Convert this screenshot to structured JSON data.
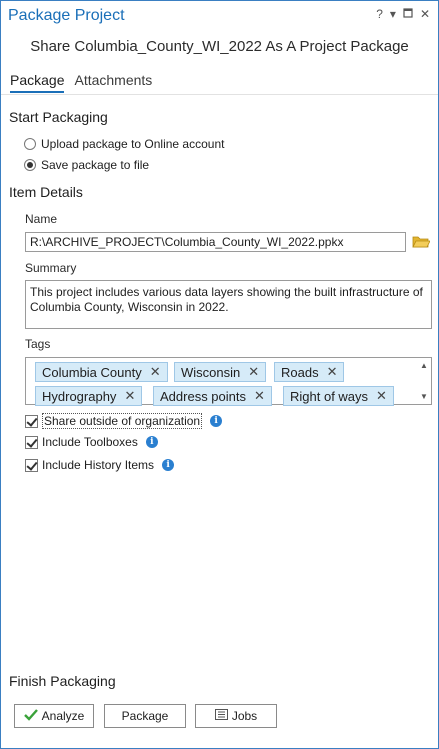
{
  "window": {
    "title": "Package Project",
    "help_glyph": "?",
    "menu_glyph": "▾",
    "float_glyph": "▢",
    "close_glyph": "✕"
  },
  "subtitle": "Share Columbia_County_WI_2022 As A Project Package",
  "tabs": [
    {
      "label": "Package",
      "active": true
    },
    {
      "label": "Attachments",
      "active": false
    }
  ],
  "start_packaging": {
    "heading": "Start Packaging",
    "options": [
      {
        "label": "Upload package to Online account",
        "selected": false
      },
      {
        "label": "Save package to file",
        "selected": true
      }
    ]
  },
  "item_details": {
    "heading": "Item Details",
    "name_label": "Name",
    "name_value": "R:\\ARCHIVE_PROJECT\\Columbia_County_WI_2022.ppkx",
    "summary_label": "Summary",
    "summary_value": "This project includes various data layers showing the built infrastructure of Columbia County, Wisconsin in 2022.",
    "tags_label": "Tags",
    "tags": [
      "Columbia County",
      "Wisconsin",
      "Roads",
      "Hydrography",
      "Address points",
      "Right of ways"
    ],
    "tag_remove_glyph": "✕"
  },
  "options": [
    {
      "label": "Share outside of organization",
      "checked": true
    },
    {
      "label": "Include Toolboxes",
      "checked": true
    },
    {
      "label": "Include History Items",
      "checked": true
    }
  ],
  "info_glyph": "i",
  "finish": {
    "heading": "Finish Packaging",
    "analyze_label": "Analyze",
    "package_label": "Package",
    "jobs_label": "Jobs"
  },
  "colors": {
    "accent": "#1a6fb8",
    "tag_bg": "#d6ebf8",
    "info": "#2a7fd0",
    "analyze_check": "#3aa23a",
    "folder": "#e2b531"
  }
}
